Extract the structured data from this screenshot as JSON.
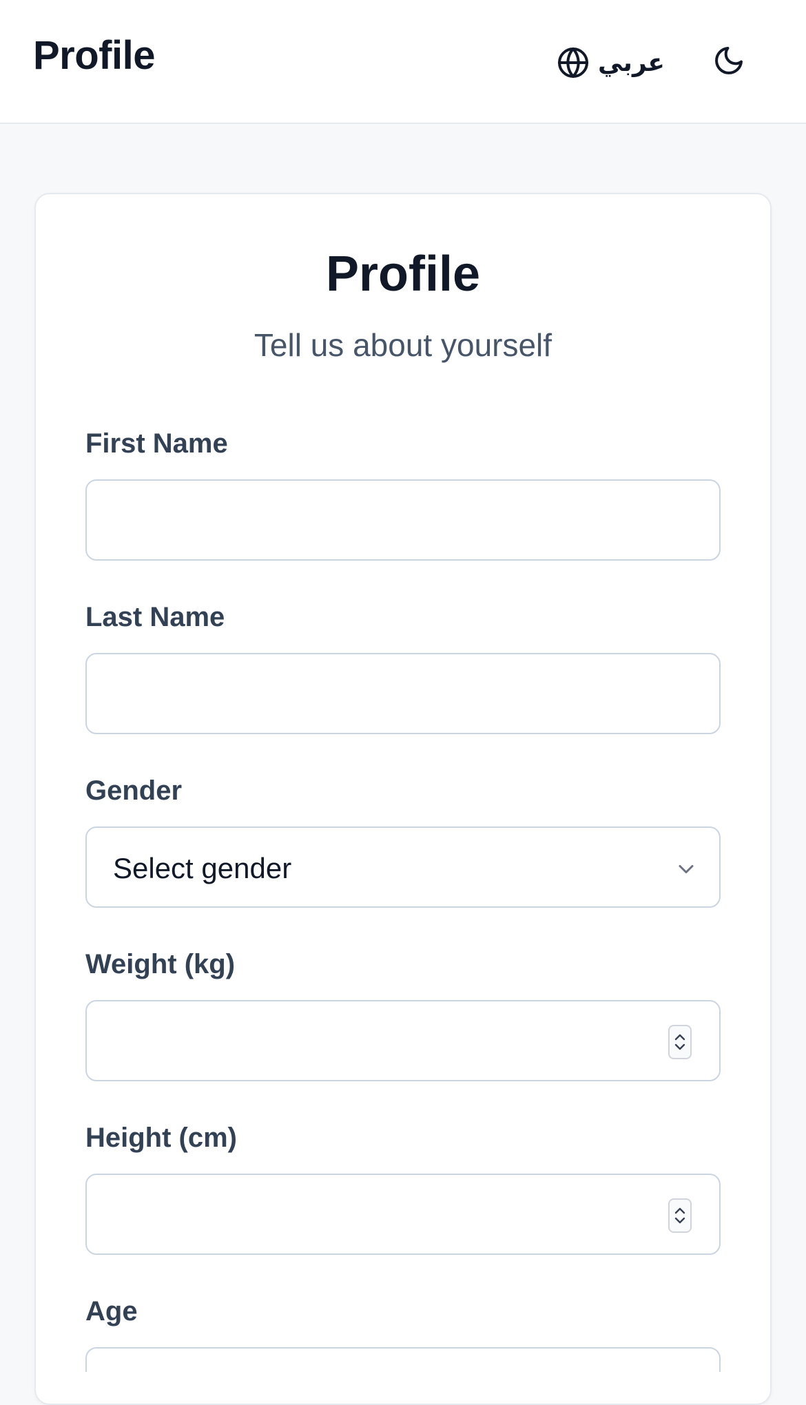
{
  "header": {
    "title": "Profile",
    "language_label": "عربي",
    "language_icon": "globe-icon",
    "theme_icon": "moon-icon"
  },
  "form": {
    "title": "Profile",
    "subtitle": "Tell us about yourself",
    "fields": {
      "first_name": {
        "label": "First Name",
        "value": ""
      },
      "last_name": {
        "label": "Last Name",
        "value": ""
      },
      "gender": {
        "label": "Gender",
        "value": "Select gender"
      },
      "weight": {
        "label": "Weight (kg)",
        "value": ""
      },
      "height": {
        "label": "Height (cm)",
        "value": ""
      },
      "age": {
        "label": "Age",
        "value": ""
      }
    }
  },
  "colors": {
    "text_primary": "#111827",
    "label": "#334155",
    "subtitle": "#475569",
    "border": "#cbd5e1",
    "background": "#f7f8fa"
  }
}
